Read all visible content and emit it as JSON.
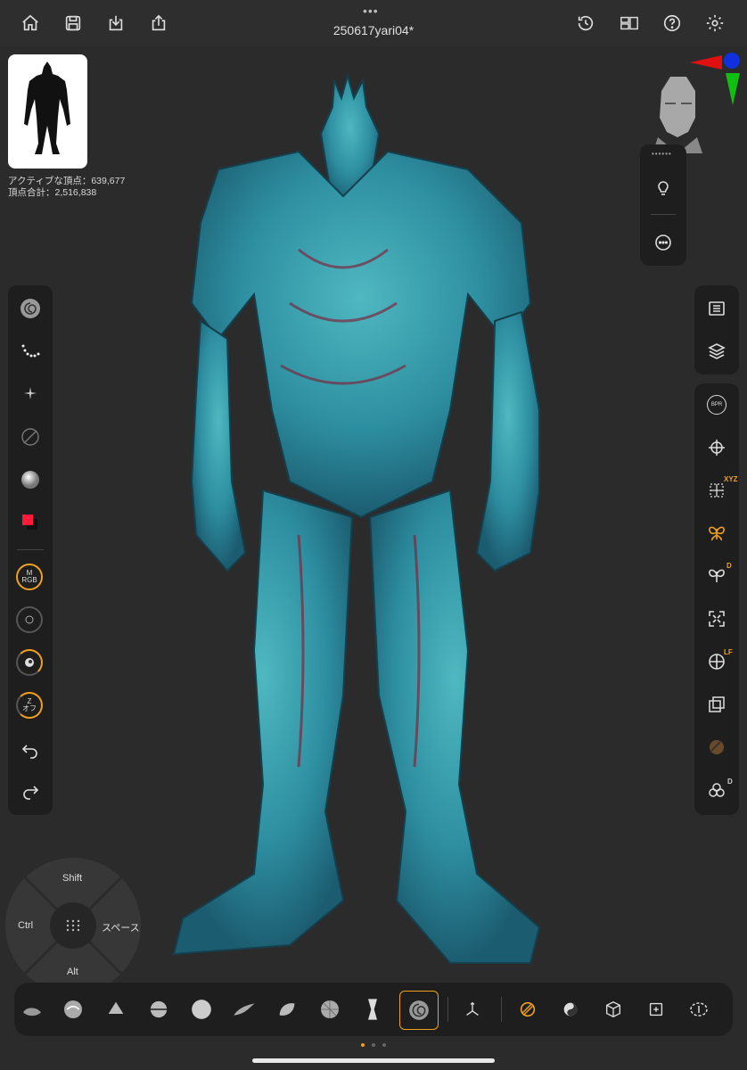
{
  "header": {
    "title": "250617yari04*",
    "left_icons": [
      "home-icon",
      "save-icon",
      "import-icon",
      "share-icon"
    ],
    "right_icons": [
      "history-icon",
      "layout-icon",
      "help-icon",
      "settings-icon"
    ]
  },
  "stats": {
    "active_vertices": "アクティブな頂点：639,677",
    "total_vertices": "頂点合計：2,516,838"
  },
  "left_panel": {
    "rings": [
      {
        "top": "M",
        "bottom": "RGB"
      },
      {
        "top": "",
        "bottom": ""
      },
      {
        "top": "",
        "bottom": ""
      },
      {
        "top": "Z",
        "bottom": "オフ"
      }
    ]
  },
  "right_panel": {
    "badges": {
      "xyz": "XYZ",
      "d1": "D",
      "lf": "LF",
      "d2": "D"
    },
    "bpr_label": "BPR"
  },
  "modifiers": {
    "shift": "Shift",
    "ctrl": "Ctrl",
    "space": "スペース",
    "alt": "Alt"
  },
  "colors": {
    "accent": "#f0a020",
    "primary_color": "#ff1a3c",
    "model": "#2f8fa0"
  }
}
